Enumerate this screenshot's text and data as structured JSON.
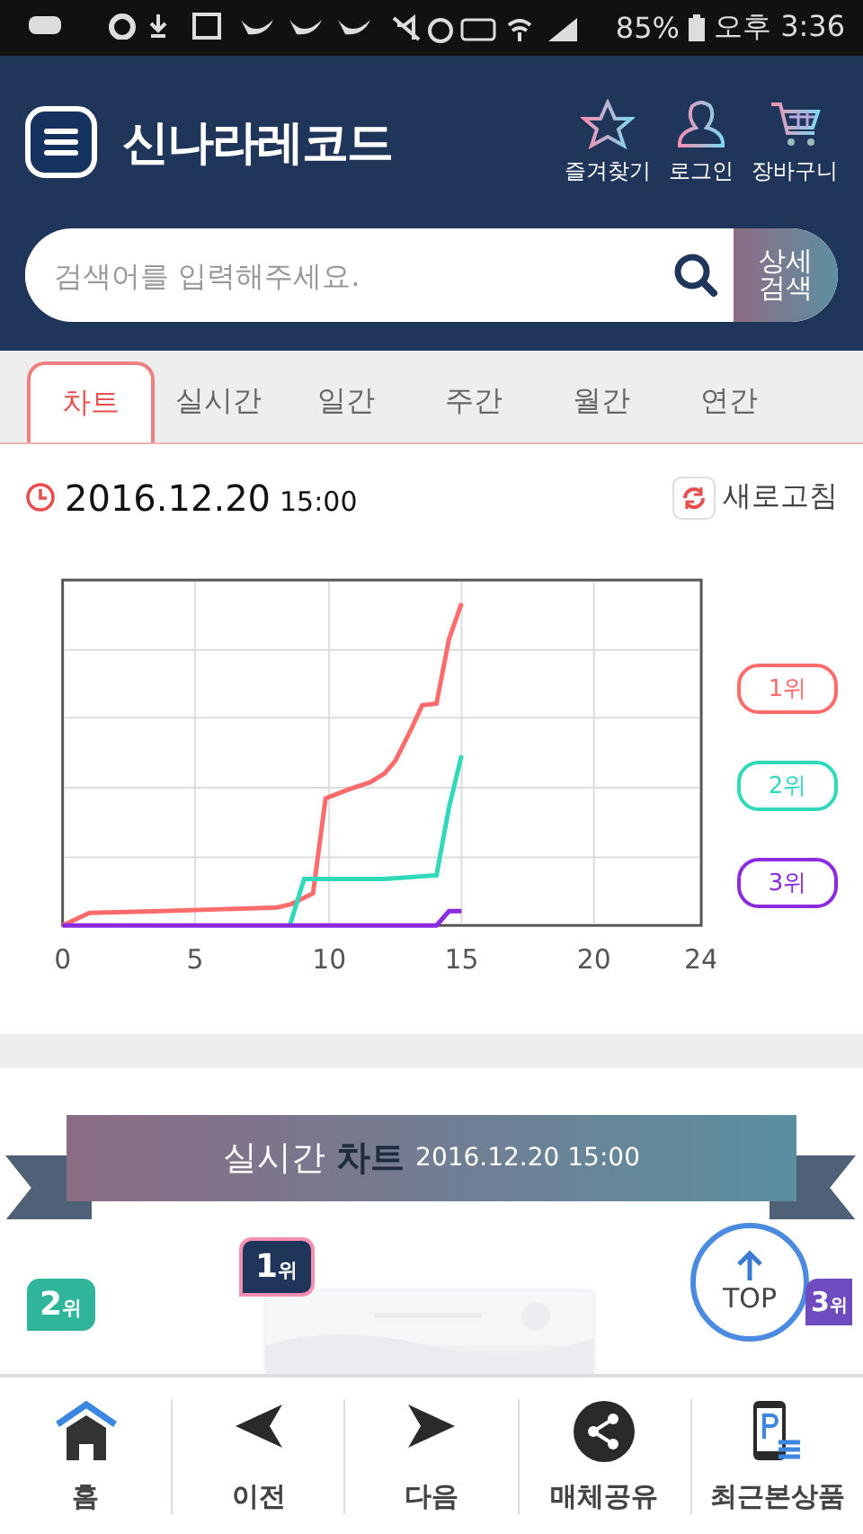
{
  "status_bar": {
    "battery": "85%",
    "time": "오후 3:36"
  },
  "header": {
    "logo": "신나라레코드",
    "actions": [
      {
        "label": "즐겨찾기",
        "kind": "star"
      },
      {
        "label": "로그인",
        "kind": "user"
      },
      {
        "label": "장바구니",
        "kind": "cart"
      }
    ]
  },
  "search": {
    "placeholder": "검색어를 입력해주세요.",
    "detail_button": [
      "상세",
      "검색"
    ]
  },
  "tabs": [
    {
      "label": "차트",
      "selected": true
    },
    {
      "label": "실시간",
      "selected": false
    },
    {
      "label": "일간",
      "selected": false
    },
    {
      "label": "주간",
      "selected": false
    },
    {
      "label": "월간",
      "selected": false
    },
    {
      "label": "연간",
      "selected": false
    }
  ],
  "chart_panel": {
    "date": "2016.12.20",
    "time": "15:00",
    "refresh": "새로고침",
    "x_ticks": [
      "0",
      "5",
      "10",
      "15",
      "20",
      "24"
    ],
    "legend": [
      {
        "label": "1위",
        "color": "#ff6b6b"
      },
      {
        "label": "2위",
        "color": "#2fd9b9"
      },
      {
        "label": "3위",
        "color": "#8a2be2"
      }
    ]
  },
  "realtime": {
    "title": "실시간 **차트**",
    "timestamp": "2016.12.20 15:00",
    "ranks": [
      {
        "number": "2",
        "suffix": "위",
        "color": "#2fb59a"
      },
      {
        "number": "1",
        "suffix": "위",
        "color": "#1f3559"
      },
      {
        "number": "3",
        "suffix": "위",
        "color": "#6f4bc0"
      }
    ]
  },
  "top_button": "TOP",
  "bottom_nav": [
    {
      "label": "홈",
      "kind": "home"
    },
    {
      "label": "이전",
      "kind": "prev"
    },
    {
      "label": "다음",
      "kind": "next"
    },
    {
      "label": "매체공유",
      "kind": "share"
    },
    {
      "label": "최근본상품",
      "kind": "recent"
    }
  ]
}
